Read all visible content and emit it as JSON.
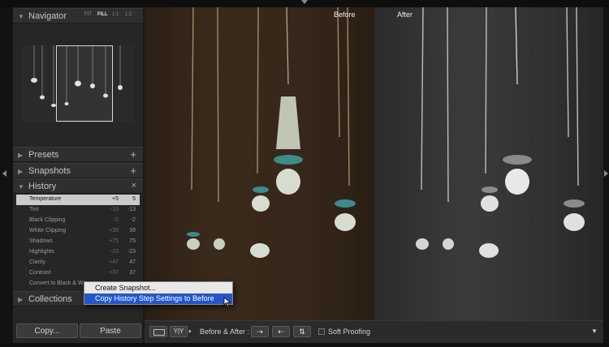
{
  "navigator": {
    "title": "Navigator",
    "zoom_options": [
      "FIT",
      "FILL",
      "1:1",
      "1:2"
    ],
    "selected_zoom": "FILL"
  },
  "panels": {
    "presets": "Presets",
    "snapshots": "Snapshots",
    "history": "History",
    "collections": "Collections",
    "add_glyph": "+",
    "close_glyph": "×",
    "expand_glyph": "▶",
    "collapse_glyph": "▼"
  },
  "history": {
    "items": [
      {
        "name": "Temperature",
        "before": "+5",
        "after": "5",
        "selected": true
      },
      {
        "name": "Tint",
        "before": "-13",
        "after": "-13"
      },
      {
        "name": "Black Clipping",
        "before": "-2",
        "after": "-2"
      },
      {
        "name": "White Clipping",
        "before": "+39",
        "after": "39"
      },
      {
        "name": "Shadows",
        "before": "+75",
        "after": "75"
      },
      {
        "name": "Highlights",
        "before": "-23",
        "after": "-23"
      },
      {
        "name": "Clarity",
        "before": "+47",
        "after": "47"
      },
      {
        "name": "Contrast",
        "before": "+37",
        "after": "37"
      },
      {
        "name": "Convert to Black & W",
        "before": "",
        "after": ""
      }
    ]
  },
  "context_menu": {
    "items": [
      "Create Snapshot...",
      "Copy History Step Settings to Before"
    ],
    "highlighted": 1
  },
  "buttons": {
    "copy": "Copy...",
    "paste": "Paste"
  },
  "image": {
    "before_label": "Before",
    "after_label": "After"
  },
  "toolbar": {
    "view_mode": "Y|Y",
    "before_after_label": "Before & After :",
    "soft_proofing_label": "Soft Proofing",
    "soft_proofing_checked": false
  },
  "icons": {
    "loupe_view": "loupe-view-icon",
    "before_after_view": "before-after-view-icon",
    "copy_before_to_after": "copy-before-to-after-icon",
    "copy_after_to_before": "copy-after-to-before-icon",
    "swap": "swap-icon",
    "toolbar_menu": "chevron-down-icon"
  }
}
